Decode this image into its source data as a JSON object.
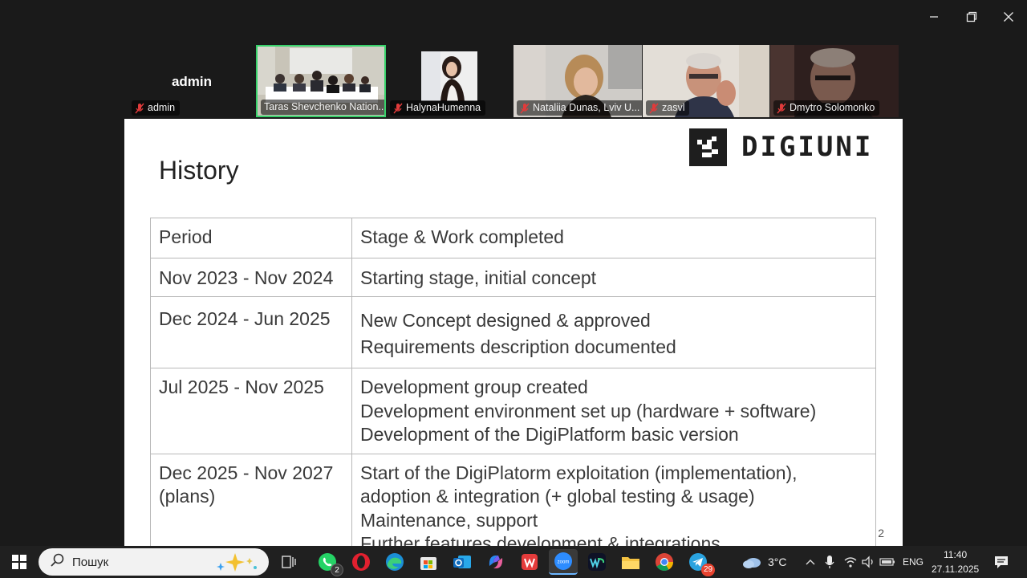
{
  "window": {
    "controls": [
      "minimize-icon",
      "restore-icon",
      "close-icon"
    ]
  },
  "participants": [
    {
      "name": "admin",
      "tag": "admin",
      "muted": true,
      "video": false
    },
    {
      "name": "Taras Shevchenko National University",
      "tag": "Taras Shevchenko Nation...",
      "muted": false,
      "video": true,
      "active_speaker": true
    },
    {
      "name": "HalynaHumenna",
      "tag": "HalynaHumenna",
      "muted": true,
      "video": true
    },
    {
      "name": "Nataliia Dunas, Lviv U...",
      "tag": "Nataliia Dunas, Lviv U...",
      "muted": true,
      "video": true
    },
    {
      "name": "zasvl",
      "tag": "zasvl",
      "muted": true,
      "video": true
    },
    {
      "name": "Dmytro Solomonko",
      "tag": "Dmytro Solomonko",
      "muted": true,
      "video": true
    }
  ],
  "slide": {
    "title": "History",
    "logo_text": "DIGIUNI",
    "page_number": "2",
    "table": {
      "headers": [
        "Period",
        "Stage & Work completed"
      ],
      "rows": [
        {
          "period": [
            "Nov 2023 - Nov 2024"
          ],
          "work": [
            "Starting stage, initial concept"
          ]
        },
        {
          "period": [
            "Dec 2024 - Jun 2025"
          ],
          "work": [
            "New Concept designed & approved",
            "Requirements description documented"
          ]
        },
        {
          "period": [
            "Jul 2025 - Nov 2025"
          ],
          "work": [
            "Development group created",
            "Development environment set up (hardware + software)",
            "Development of the DigiPlatform basic version"
          ]
        },
        {
          "period": [
            "Dec 2025 - Nov 2027",
            "(plans)"
          ],
          "work": [
            "Start of the DigiPlatorm exploitation (implementation),",
            "adoption & integration (+ global testing & usage)",
            "Maintenance, support",
            "Further features development & integrations"
          ]
        }
      ]
    }
  },
  "taskbar": {
    "search_placeholder": "Пошук",
    "whatsapp_badge": "2",
    "telegram_badge": "29",
    "apps": [
      "start-icon",
      "search-icon",
      "task-view-icon",
      "whatsapp-icon",
      "opera-icon",
      "edge-icon",
      "store-icon",
      "outlook-icon",
      "copilot-icon",
      "wps-icon",
      "zoom-icon",
      "webex-icon",
      "file-explorer-icon",
      "chrome-icon",
      "telegram-icon"
    ],
    "weather": "3°C",
    "language": "ENG",
    "time": "11:40",
    "date": "27.11.2025"
  }
}
